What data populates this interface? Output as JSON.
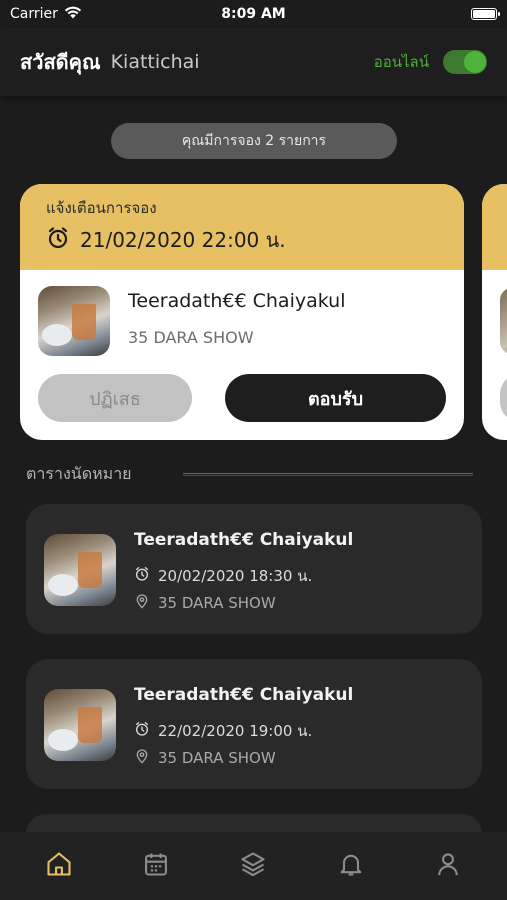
{
  "status_bar": {
    "carrier": "Carrier",
    "time": "8:09 AM"
  },
  "header": {
    "greeting": "สวัสดีคุณ",
    "username": "Kiattichai",
    "online_label": "ออนไลน์",
    "online_toggle_on": true
  },
  "booking_summary": "คุณมีการจอง 2 รายการ",
  "notification": {
    "title": "แจ้งเตือนการจอง",
    "datetime": "21/02/2020 22:00 น.",
    "name": "Teeradath€€  Chaiyakul",
    "place": "35 DARA SHOW",
    "reject_label": "ปฏิเสธ",
    "accept_label": "ตอบรับ"
  },
  "schedule": {
    "title": "ตารางนัดหมาย",
    "items": [
      {
        "name": "Teeradath€€  Chaiyakul",
        "datetime": "20/02/2020 18:30 น.",
        "place": "35 DARA SHOW"
      },
      {
        "name": "Teeradath€€  Chaiyakul",
        "datetime": "22/02/2020 19:00 น.",
        "place": "35 DARA SHOW"
      }
    ]
  },
  "colors": {
    "accent_yellow": "#e6c063",
    "online_green": "#4caf3c",
    "background": "#1c1c1c",
    "active_nav": "#e6c063"
  },
  "bottom_nav": [
    {
      "icon": "home-icon",
      "active": true
    },
    {
      "icon": "calendar-icon",
      "active": false
    },
    {
      "icon": "layers-icon",
      "active": false
    },
    {
      "icon": "bell-icon",
      "active": false
    },
    {
      "icon": "user-icon",
      "active": false
    }
  ]
}
